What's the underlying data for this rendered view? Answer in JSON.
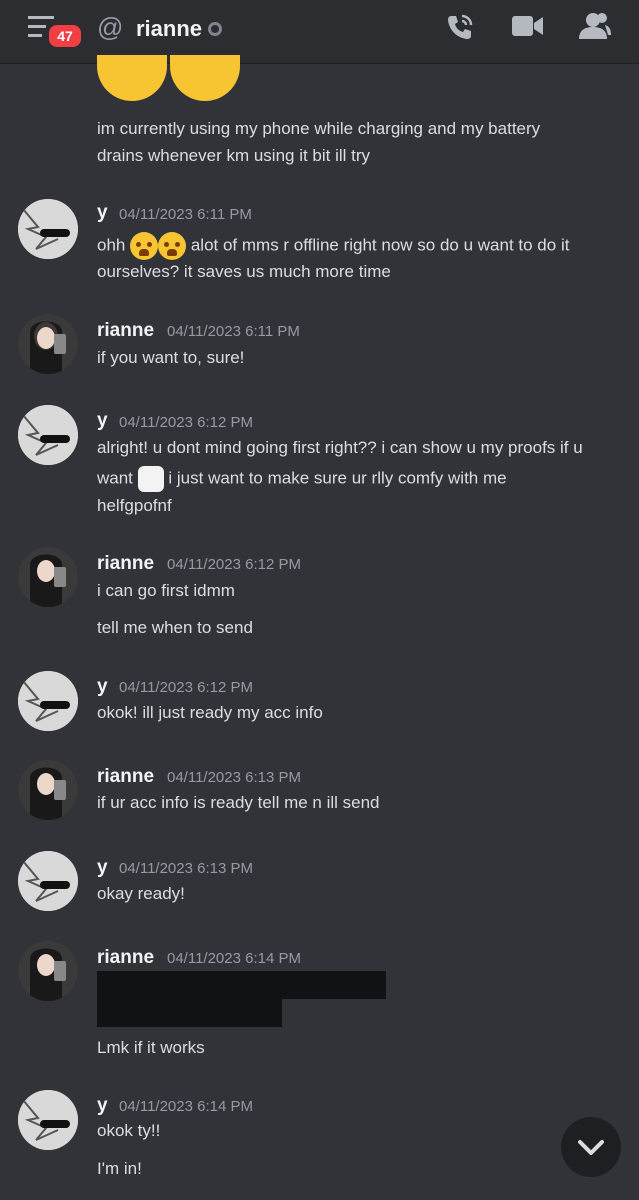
{
  "header": {
    "badge_count": "47",
    "channel_name": "rianne",
    "icons": [
      "menu-icon",
      "at-icon",
      "call-icon",
      "video-icon",
      "members-icon"
    ]
  },
  "messages": [
    {
      "lines": [
        "im currently using my phone while charging and my battery",
        "drains whenever km using it bit ill try"
      ]
    },
    {
      "author": "y",
      "time": "04/11/2023 6:11 PM",
      "lines": [
        "ohh",
        "alot of mms r offline right now so do u want to do it",
        "ourselves? it saves us much more time"
      ]
    },
    {
      "author": "rianne",
      "time": "04/11/2023 6:11 PM",
      "lines": [
        "if you want to, sure!"
      ]
    },
    {
      "author": "y",
      "time": "04/11/2023 6:12 PM",
      "lines": [
        "alright! u dont mind going first right?? i can show u my proofs if u",
        "want",
        "i just want to make sure ur rlly comfy with me",
        "helfgpofnf"
      ]
    },
    {
      "author": "rianne",
      "time": "04/11/2023 6:12 PM",
      "lines": [
        "i can go first idmm",
        "tell me when to send"
      ]
    },
    {
      "author": "y",
      "time": "04/11/2023 6:12 PM",
      "lines": [
        "okok! ill just ready my acc info"
      ]
    },
    {
      "author": "rianne",
      "time": "04/11/2023 6:13 PM",
      "lines": [
        "if ur acc info is ready tell me n ill send"
      ]
    },
    {
      "author": "y",
      "time": "04/11/2023 6:13 PM",
      "lines": [
        "okay ready!"
      ]
    },
    {
      "author": "rianne",
      "time": "04/11/2023 6:14 PM",
      "lines": [
        "Lmk if it works"
      ]
    },
    {
      "author": "y",
      "time": "04/11/2023 6:14 PM",
      "lines": [
        "okok ty!!",
        "I'm in!"
      ]
    }
  ],
  "colors": {
    "background": "#313338",
    "header": "#2b2d31",
    "badge": "#f23f43",
    "text": "#dbdee1",
    "muted": "#949ba4"
  }
}
